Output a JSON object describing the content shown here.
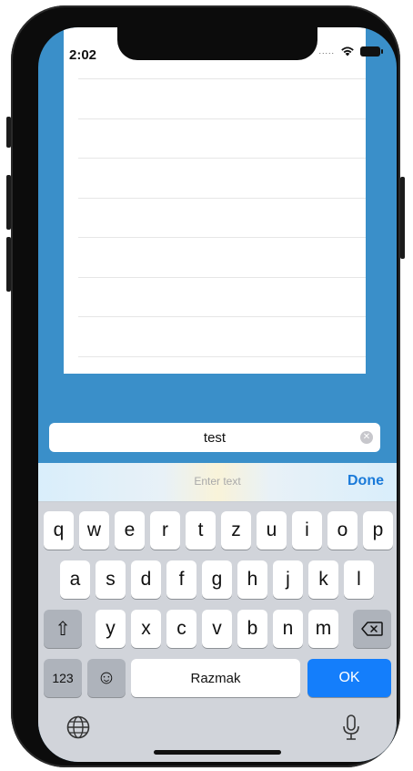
{
  "status_bar": {
    "time": "2:02",
    "signal_dots": "....."
  },
  "text_field": {
    "value": "test",
    "clear_icon": "clear-icon"
  },
  "accessory_bar": {
    "placeholder": "Enter text",
    "done_label": "Done"
  },
  "keyboard": {
    "row1": [
      "q",
      "w",
      "e",
      "r",
      "t",
      "z",
      "u",
      "i",
      "o",
      "p"
    ],
    "row2": [
      "a",
      "s",
      "d",
      "f",
      "g",
      "h",
      "j",
      "k",
      "l"
    ],
    "row3": [
      "y",
      "x",
      "c",
      "v",
      "b",
      "n",
      "m"
    ],
    "numbers_label": "123",
    "emoji": "☺",
    "space_label": "Razmak",
    "return_label": "OK",
    "shift_glyph": "⇧"
  },
  "colors": {
    "background_blue": "#3a8fc9",
    "accent": "#1a7ad9",
    "ok_button": "#147efb"
  }
}
